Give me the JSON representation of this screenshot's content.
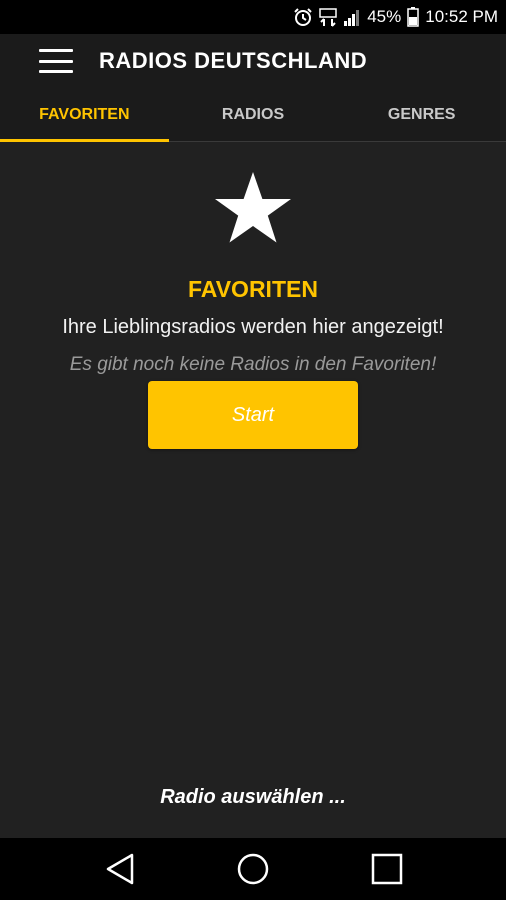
{
  "status_bar": {
    "battery": "45%",
    "time": "10:52 PM",
    "icons": [
      "alarm-icon",
      "data-icon",
      "signal-icon",
      "battery-icon"
    ]
  },
  "app_bar": {
    "title": "RADIOS DEUTSCHLAND",
    "menu_icon": "hamburger-menu-icon"
  },
  "tabs": [
    {
      "label": "FAVORITEN",
      "active": true
    },
    {
      "label": "RADIOS",
      "active": false
    },
    {
      "label": "GENRES",
      "active": false
    }
  ],
  "main": {
    "icon": "star-icon",
    "heading": "FAVORITEN",
    "subtitle": "Ihre Lieblingsradios werden hier angezeigt!",
    "empty_message": "Es gibt noch keine Radios in den Favoriten!",
    "start_button": "Start"
  },
  "footer": {
    "radio_select": "Radio auswählen ..."
  },
  "nav_bar": {
    "icons": [
      "back-icon",
      "home-icon",
      "recents-icon"
    ]
  },
  "colors": {
    "accent": "#ffc400",
    "background": "#212121",
    "app_bar": "#1b1b1b",
    "status_bar": "#000000"
  }
}
